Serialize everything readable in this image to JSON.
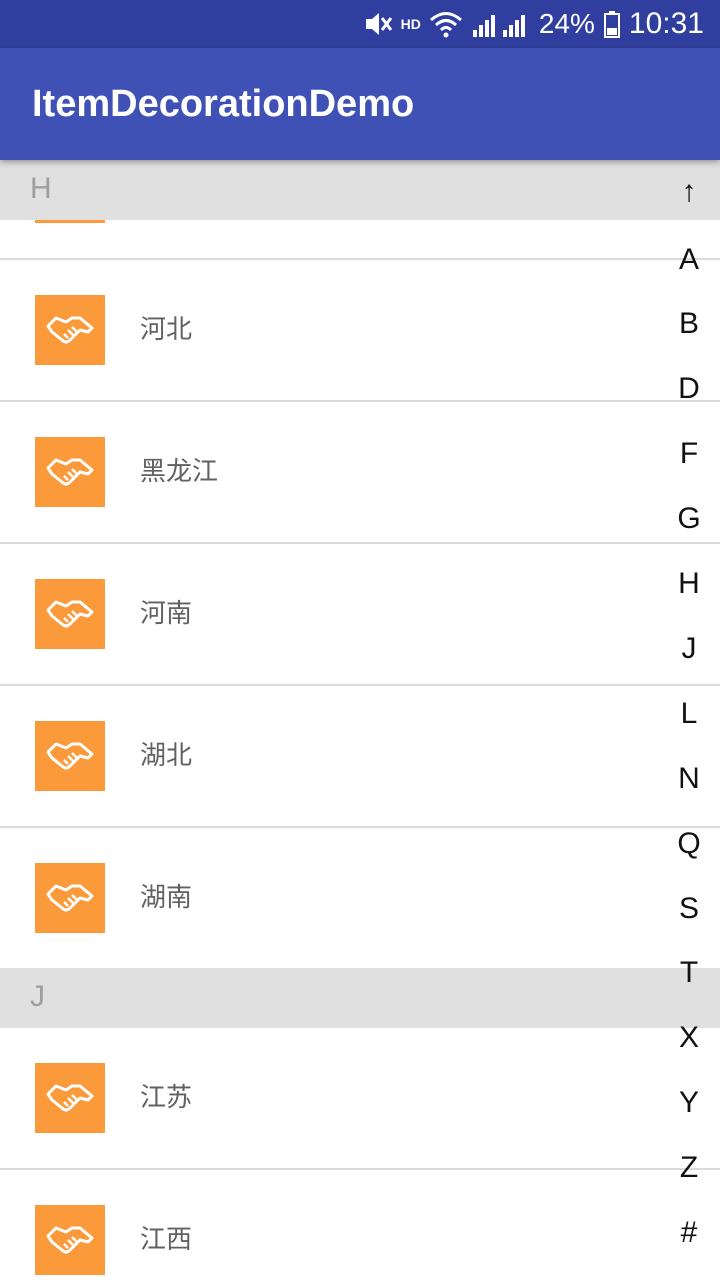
{
  "status_bar": {
    "hd": "HD",
    "network": "4G",
    "battery": "24%",
    "time": "10:31",
    "icons": [
      "mute-icon",
      "wifi-icon",
      "signal-icon",
      "battery-icon"
    ]
  },
  "app_bar": {
    "title": "ItemDecorationDemo"
  },
  "list": {
    "sections": [
      {
        "letter": "H",
        "items": [
          "河北",
          "黑龙江",
          "河南",
          "湖北",
          "湖南"
        ]
      },
      {
        "letter": "J",
        "items": [
          "江苏",
          "江西"
        ]
      }
    ],
    "item_icon": "handshake-icon",
    "item_icon_color": "#FB9A3B"
  },
  "index_bar": {
    "items": [
      "↑",
      "A",
      "B",
      "D",
      "F",
      "G",
      "H",
      "J",
      "L",
      "N",
      "Q",
      "S",
      "T",
      "X",
      "Y",
      "Z",
      "#"
    ]
  },
  "colors": {
    "status_bar": "#303F9F",
    "app_bar": "#3F51B5",
    "section_header": "#E0E0E0"
  }
}
